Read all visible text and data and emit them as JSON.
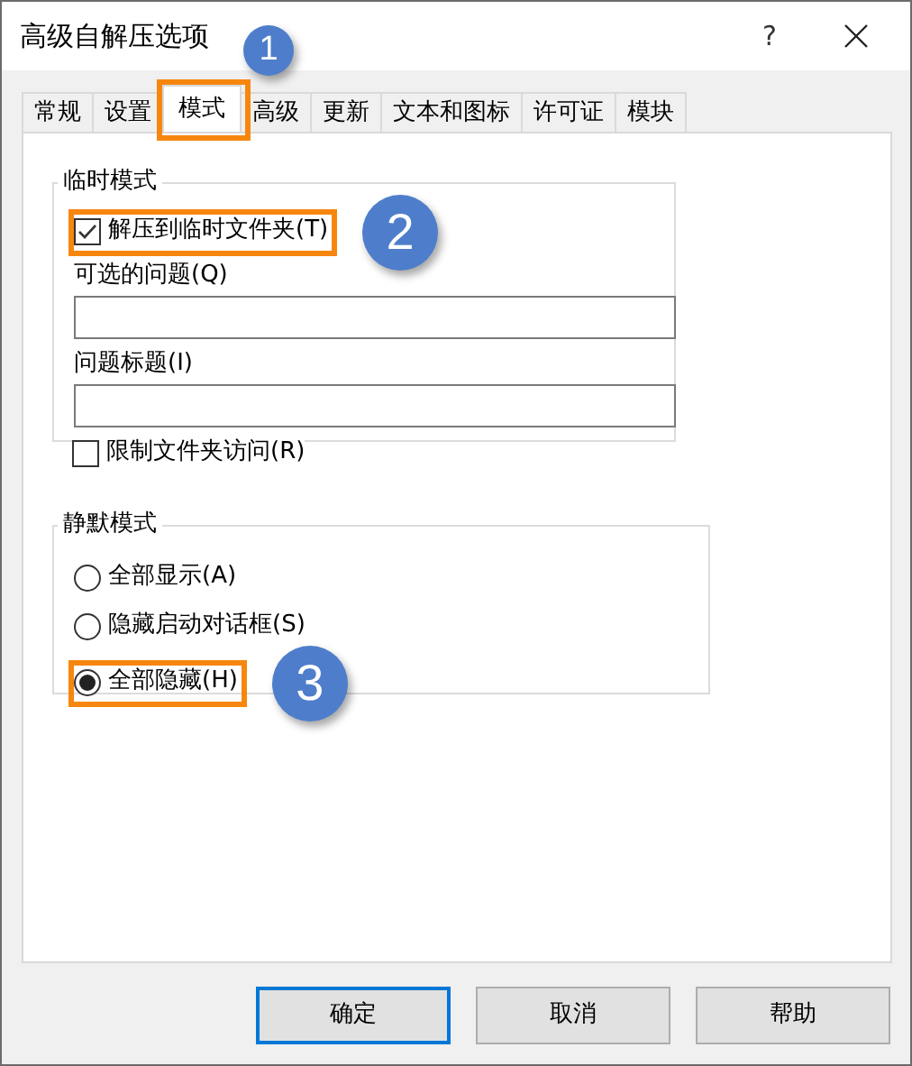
{
  "window": {
    "title": "高级自解压选项",
    "help": "?"
  },
  "tabs": [
    {
      "label": "常规",
      "selected": false
    },
    {
      "label": "设置",
      "selected": false
    },
    {
      "label": "模式",
      "selected": true
    },
    {
      "label": "高级",
      "selected": false
    },
    {
      "label": "更新",
      "selected": false
    },
    {
      "label": "文本和图标",
      "selected": false
    },
    {
      "label": "许可证",
      "selected": false
    },
    {
      "label": "模块",
      "selected": false
    }
  ],
  "temp_mode": {
    "title": "临时模式",
    "extract": {
      "label": "解压到临时文件夹(T)",
      "checked": true
    },
    "fields": [
      {
        "label": "可选的问题(Q)"
      },
      {
        "label": "问题标题(I)"
      }
    ]
  },
  "restrict": {
    "label": "限制文件夹访问(R)",
    "checked": false
  },
  "silent_mode": {
    "title": "静默模式",
    "options": [
      {
        "label": "全部显示(A)",
        "selected": false
      },
      {
        "label": "隐藏启动对话框(S)",
        "selected": false
      },
      {
        "label": "全部隐藏(H)",
        "selected": true
      }
    ]
  },
  "buttons": [
    {
      "label": "确定",
      "default": true
    },
    {
      "label": "取消",
      "default": false
    },
    {
      "label": "帮助",
      "default": false
    }
  ],
  "callouts": [
    {
      "number": "1"
    },
    {
      "number": "2"
    },
    {
      "number": "3"
    }
  ]
}
